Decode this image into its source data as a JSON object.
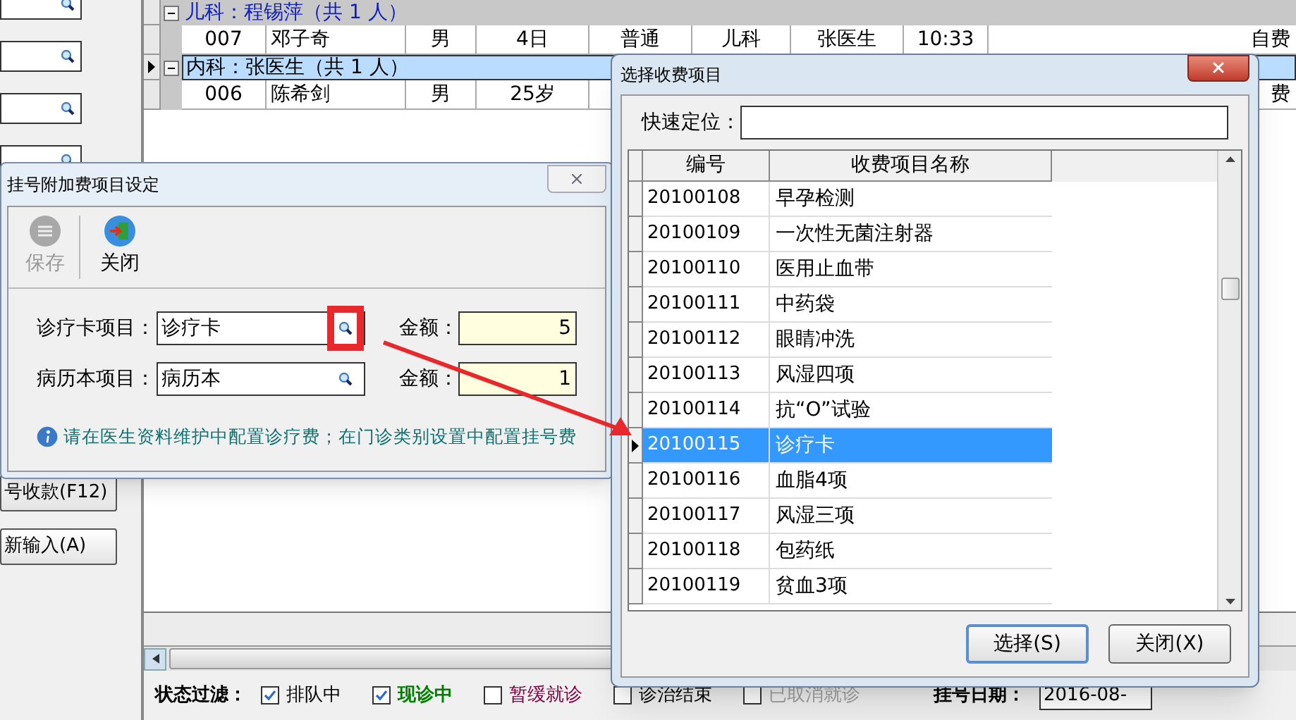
{
  "left_panel": {
    "buttons": [
      "号收款(F12)",
      "新输入(A)"
    ]
  },
  "grid": {
    "groups": [
      {
        "label": "儿科：程锡萍（共 1 人）",
        "selected": false,
        "rows": [
          {
            "cells": [
              "007",
              "邓子奇",
              "男",
              "4日",
              "普通",
              "儿科",
              "张医生",
              "10:33"
            ],
            "last": "自费"
          }
        ]
      },
      {
        "label": "内科：张医生（共 1 人）",
        "selected": true,
        "rows": [
          {
            "cells": [
              "006",
              "陈希剑",
              "男",
              "25岁"
            ],
            "last": "费"
          }
        ]
      }
    ]
  },
  "filter": {
    "label": "状态过滤：",
    "options": [
      {
        "label": "排队中",
        "checked": true,
        "color": "#000000"
      },
      {
        "label": "现诊中",
        "checked": true,
        "color": "#008000"
      },
      {
        "label": "暂缓就诊",
        "checked": false,
        "color": "#800040"
      },
      {
        "label": "诊治结束",
        "checked": false,
        "color": "#000000"
      },
      {
        "label": "已取消就诊",
        "checked": false,
        "color": "#a0a0a0"
      }
    ]
  },
  "date": {
    "label": "挂号日期：",
    "value": "2016-08-"
  },
  "fee_dialog": {
    "title": "挂号附加费项目设定",
    "toolbar": [
      {
        "label": "保存",
        "kind": "save",
        "disabled": true
      },
      {
        "label": "关闭",
        "kind": "close",
        "disabled": false
      }
    ],
    "fields": [
      {
        "label": "诊疗卡项目：",
        "value": "诊疗卡",
        "amount_label": "金额：",
        "amount": "5",
        "highlighted": true
      },
      {
        "label": "病历本项目：",
        "value": "病历本",
        "amount_label": "金额：",
        "amount": "1",
        "highlighted": false
      }
    ],
    "info": "请在医生资料维护中配置诊疗费；在门诊类别设置中配置挂号费"
  },
  "select_dialog": {
    "title": "选择收费项目",
    "search_label": "快速定位：",
    "columns": [
      "编号",
      "收费项目名称"
    ],
    "rows": [
      {
        "code": "20100108",
        "name": "早孕检测",
        "selected": false
      },
      {
        "code": "20100109",
        "name": "一次性无菌注射器",
        "selected": false
      },
      {
        "code": "20100110",
        "name": "医用止血带",
        "selected": false
      },
      {
        "code": "20100111",
        "name": "中药袋",
        "selected": false
      },
      {
        "code": "20100112",
        "name": "眼睛冲洗",
        "selected": false
      },
      {
        "code": "20100113",
        "name": "风湿四项",
        "selected": false
      },
      {
        "code": "20100114",
        "name": "抗“O”试验",
        "selected": false
      },
      {
        "code": "20100115",
        "name": "诊疗卡",
        "selected": true
      },
      {
        "code": "20100116",
        "name": "血脂4项",
        "selected": false
      },
      {
        "code": "20100117",
        "name": "风湿三项",
        "selected": false
      },
      {
        "code": "20100118",
        "name": "包药纸",
        "selected": false
      },
      {
        "code": "20100119",
        "name": "贫血3项",
        "selected": false
      }
    ],
    "buttons": [
      "选择(S)",
      "关闭(X)"
    ]
  }
}
